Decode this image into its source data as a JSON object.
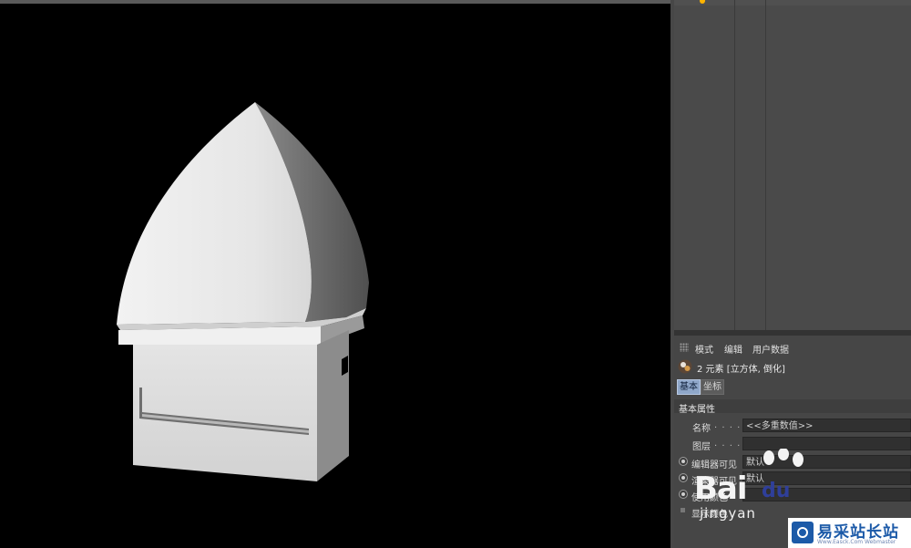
{
  "attribute_manager": {
    "menu": [
      "模式",
      "编辑",
      "用户数据"
    ],
    "selection_text": "2 元素 [立方体, 倒化]",
    "tabs": [
      "基本",
      "坐标"
    ],
    "section_title": "基本属性",
    "properties": [
      {
        "label": "名称",
        "dots": ". . . . .",
        "value": "<<多重数值>>",
        "control": "none"
      },
      {
        "label": "图层",
        "dots": ". . . . .",
        "value": "",
        "control": "none"
      },
      {
        "label": "编辑器可见",
        "dots": "",
        "value": "默认",
        "control": "radio"
      },
      {
        "label": "渲染器可见",
        "dots": "",
        "value": "默认",
        "control": "radio"
      },
      {
        "label": "使用颜色",
        "dots": "",
        "value": "",
        "control": "radio"
      },
      {
        "label": "显示颜色",
        "dots": "",
        "value": "",
        "control": "check"
      }
    ]
  },
  "watermarks": {
    "baidu": "Bai",
    "baidu_du": "du",
    "baidu_sub": "jingyan",
    "site_name": "易采站长站",
    "site_url": "Www.Easck.Com Webmaster"
  },
  "colors": {
    "viewport_bg": "#000000",
    "panel_bg": "#474747",
    "tab_active": "#8fa7c9",
    "object_marker": "#ffb400",
    "site_blue": "#1c5aa8"
  }
}
